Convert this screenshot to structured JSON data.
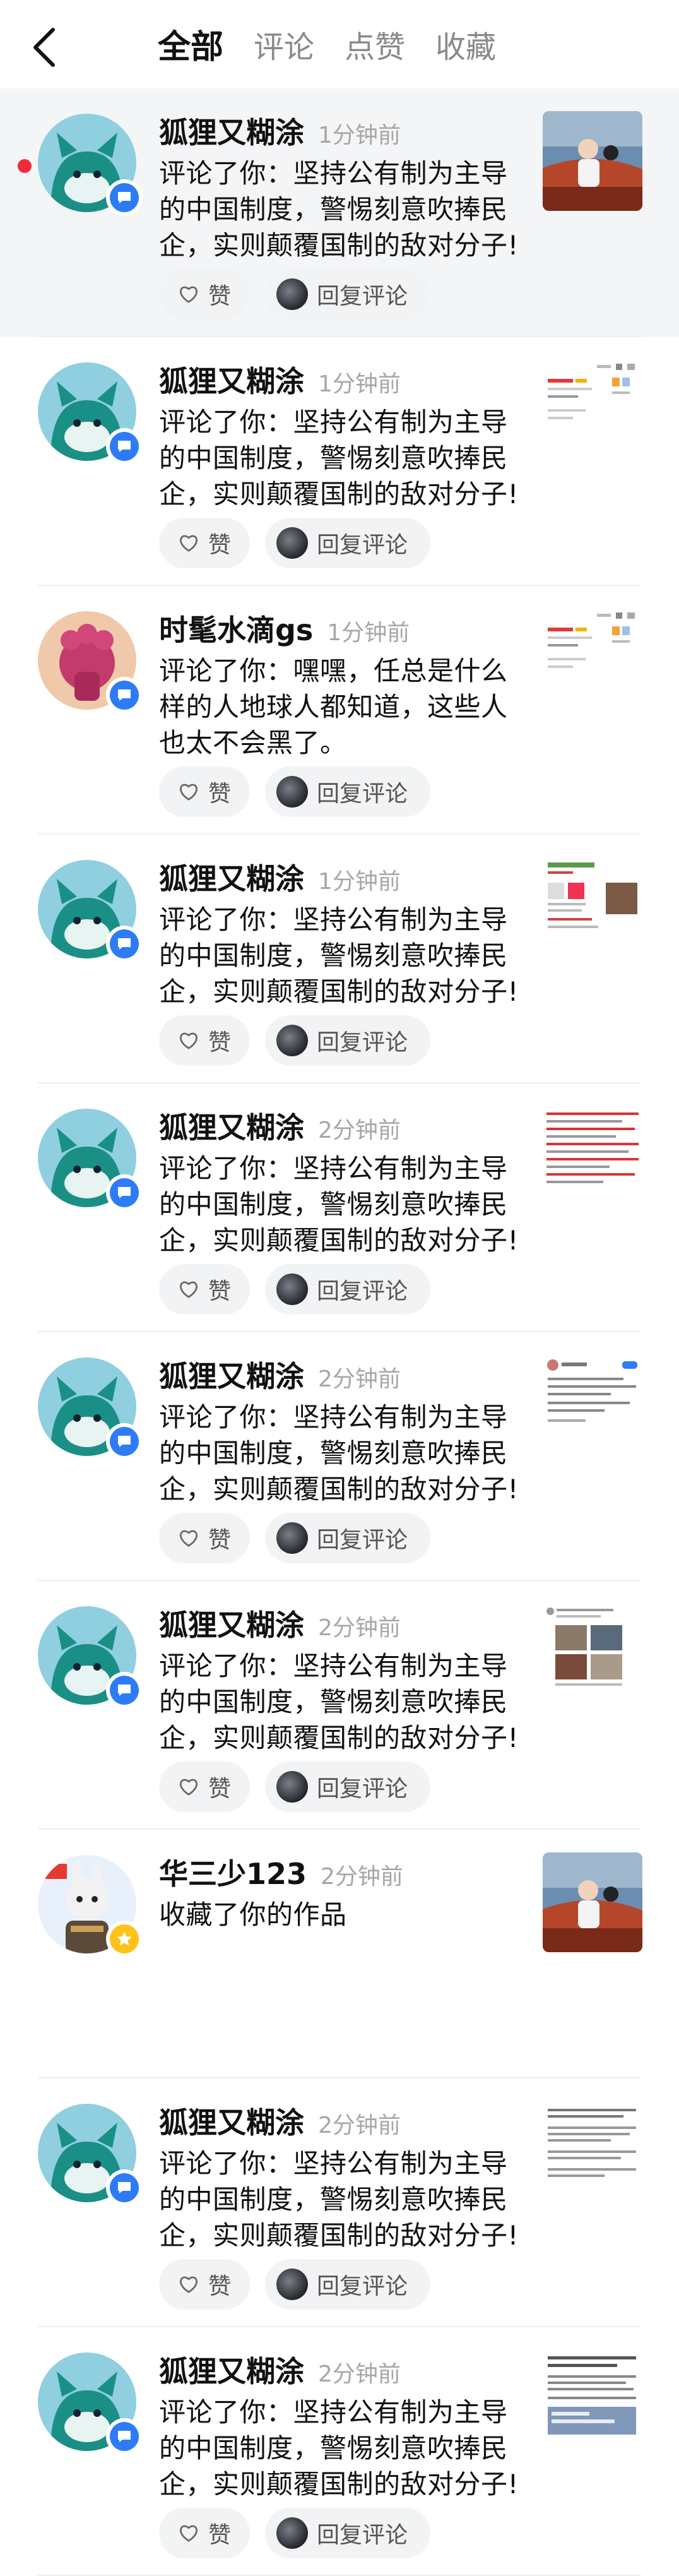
{
  "header": {
    "tabs": [
      {
        "label": "全部"
      },
      {
        "label": "评论"
      },
      {
        "label": "点赞"
      },
      {
        "label": "收藏"
      }
    ]
  },
  "actions": {
    "like_label": "赞",
    "reply_label": "回复评论"
  },
  "items": [
    {
      "name": "狐狸又糊涂",
      "time": "1分钟前",
      "text": "评论了你：坚持公有制为主导的中国制度，警惕刻意吹捧民企，实则颠覆国制的敌对分子!",
      "badge": "comment",
      "avatar": "fox",
      "thumb": "video",
      "unread": true,
      "actions": true
    },
    {
      "name": "狐狸又糊涂",
      "time": "1分钟前",
      "text": "评论了你：坚持公有制为主导的中国制度，警惕刻意吹捧民企，实则颠覆国制的敌对分子!",
      "badge": "comment",
      "avatar": "fox",
      "thumb": "doc",
      "unread": false,
      "actions": true
    },
    {
      "name": "时髦水滴gs",
      "time": "1分钟前",
      "text": "评论了你：嘿嘿，任总是什么样的人地球人都知道，这些人也太不会黑了。",
      "badge": "comment",
      "avatar": "pink",
      "thumb": "doc",
      "unread": false,
      "actions": true
    },
    {
      "name": "狐狸又糊涂",
      "time": "1分钟前",
      "text": "评论了你：坚持公有制为主导的中国制度，警惕刻意吹捧民企，实则颠覆国制的敌对分子!",
      "badge": "comment",
      "avatar": "fox",
      "thumb": "news",
      "unread": false,
      "actions": true
    },
    {
      "name": "狐狸又糊涂",
      "time": "2分钟前",
      "text": "评论了你：坚持公有制为主导的中国制度，警惕刻意吹捧民企，实则颠覆国制的敌对分子!",
      "badge": "comment",
      "avatar": "fox",
      "thumb": "redtext",
      "unread": false,
      "actions": true
    },
    {
      "name": "狐狸又糊涂",
      "time": "2分钟前",
      "text": "评论了你：坚持公有制为主导的中国制度，警惕刻意吹捧民企，实则颠覆国制的敌对分子!",
      "badge": "comment",
      "avatar": "fox",
      "thumb": "weibo",
      "unread": false,
      "actions": true
    },
    {
      "name": "狐狸又糊涂",
      "time": "2分钟前",
      "text": "评论了你：坚持公有制为主导的中国制度，警惕刻意吹捧民企，实则颠覆国制的敌对分子!",
      "badge": "comment",
      "avatar": "fox",
      "thumb": "photos",
      "unread": false,
      "actions": true
    },
    {
      "name": "华三少123",
      "time": "2分钟前",
      "text": "收藏了你的作品",
      "badge": "star",
      "avatar": "cartoon",
      "thumb": "video",
      "unread": false,
      "actions": false
    },
    {
      "name": "狐狸又糊涂",
      "time": "2分钟前",
      "text": "评论了你：坚持公有制为主导的中国制度，警惕刻意吹捧民企，实则颠覆国制的敌对分子!",
      "badge": "comment",
      "avatar": "fox",
      "thumb": "article",
      "unread": false,
      "actions": true
    },
    {
      "name": "狐狸又糊涂",
      "time": "2分钟前",
      "text": "评论了你：坚持公有制为主导的中国制度，警惕刻意吹捧民企，实则颠覆国制的敌对分子!",
      "badge": "comment",
      "avatar": "fox",
      "thumb": "article2",
      "unread": false,
      "actions": true
    }
  ]
}
